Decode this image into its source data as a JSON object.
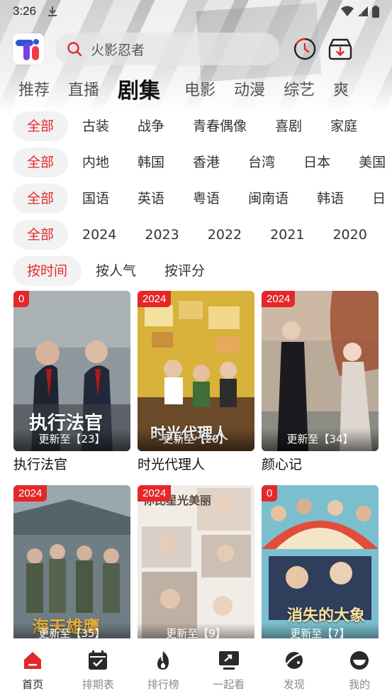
{
  "status": {
    "time": "3:26"
  },
  "header": {
    "search_placeholder": "火影忍者",
    "icons": [
      "logo-icon",
      "search-icon",
      "history-icon",
      "download-icon"
    ]
  },
  "tabs": [
    {
      "label": "推荐"
    },
    {
      "label": "直播"
    },
    {
      "label": "剧集",
      "active": true
    },
    {
      "label": "电影"
    },
    {
      "label": "动漫"
    },
    {
      "label": "综艺"
    },
    {
      "label": "爽"
    }
  ],
  "filters": {
    "genre": [
      "全部",
      "古装",
      "战争",
      "青春偶像",
      "喜剧",
      "家庭"
    ],
    "region": [
      "全部",
      "内地",
      "韩国",
      "香港",
      "台湾",
      "日本",
      "美国"
    ],
    "language": [
      "全部",
      "国语",
      "英语",
      "粤语",
      "闽南语",
      "韩语",
      "日"
    ],
    "year": [
      "全部",
      "2024",
      "2023",
      "2022",
      "2021",
      "2020"
    ],
    "sort": [
      "按时间",
      "按人气",
      "按评分"
    ]
  },
  "cards": [
    {
      "badge": "0",
      "episode": "更新至【23】",
      "title": "执行法官",
      "poster_text": "执行法官"
    },
    {
      "badge": "2024",
      "episode": "更新至【20】",
      "title": "时光代理人",
      "poster_text": "时光代理人"
    },
    {
      "badge": "2024",
      "episode": "更新至【34】",
      "title": "颜心记",
      "poster_text": ""
    },
    {
      "badge": "2024",
      "episode": "更新至【35】",
      "title": "",
      "poster_text": "海天雄鹰"
    },
    {
      "badge": "2024",
      "episode": "更新至【9】",
      "title": "",
      "poster_text": "你比星光美丽"
    },
    {
      "badge": "0",
      "episode": "更新至【7】",
      "title": "",
      "poster_text": "消失的大象"
    }
  ],
  "nav": [
    {
      "label": "首页",
      "icon": "home-icon",
      "active": true
    },
    {
      "label": "排期表",
      "icon": "calendar-icon"
    },
    {
      "label": "排行榜",
      "icon": "flame-icon"
    },
    {
      "label": "一起看",
      "icon": "share-screen-icon"
    },
    {
      "label": "发现",
      "icon": "planet-icon"
    },
    {
      "label": "我的",
      "icon": "profile-icon"
    }
  ],
  "colors": {
    "accent": "#e4272a"
  }
}
